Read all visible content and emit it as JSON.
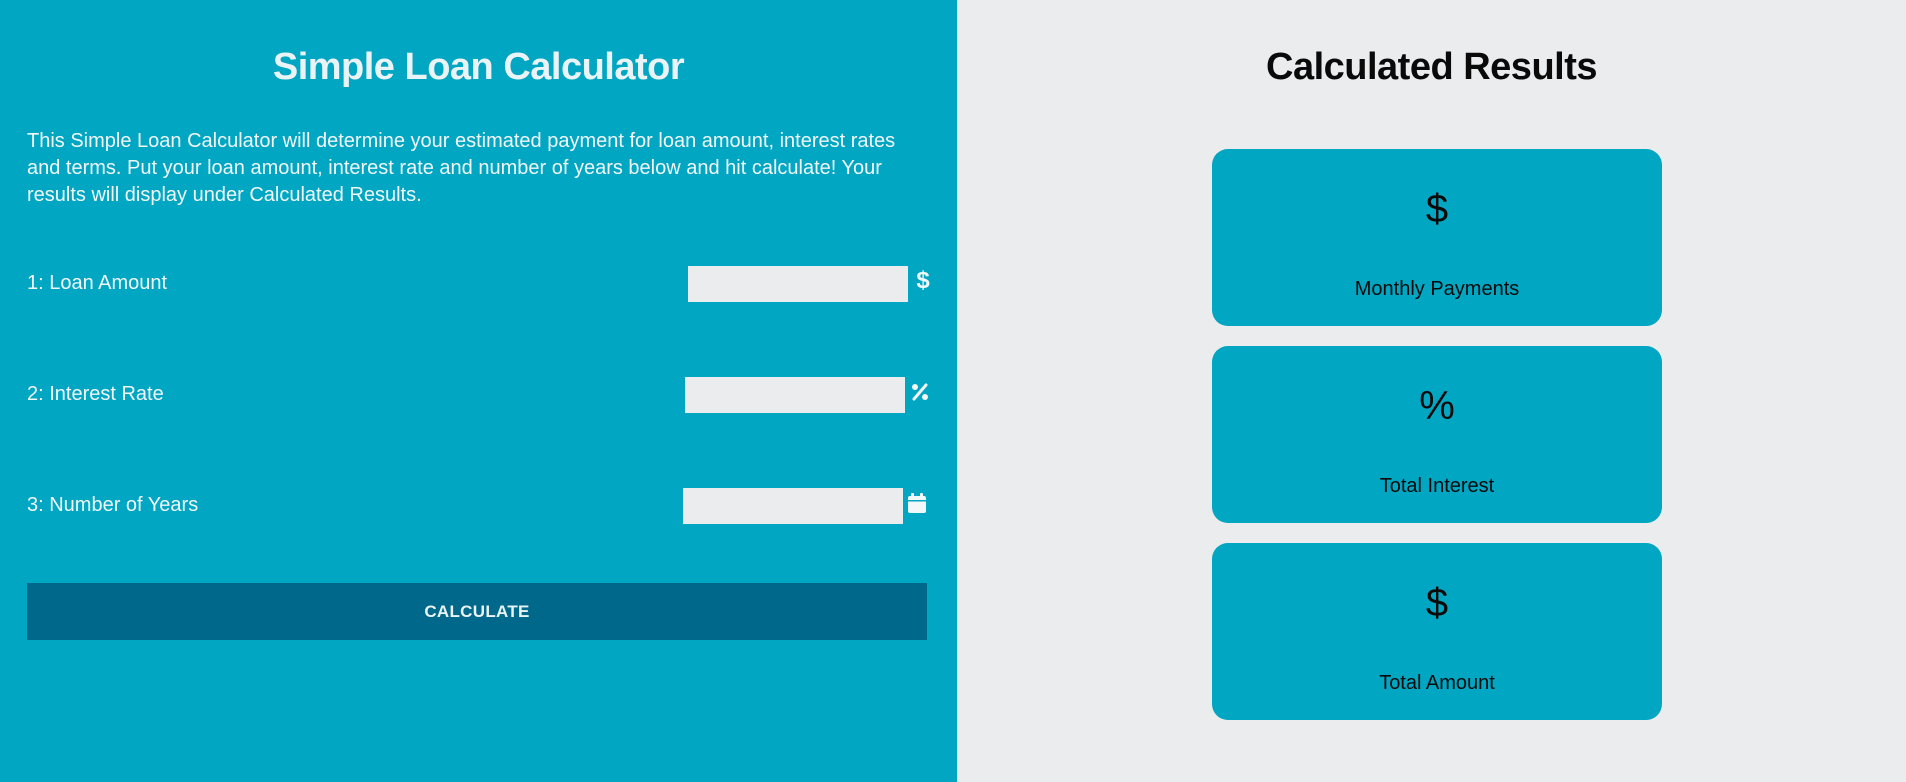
{
  "calculator": {
    "title": "Simple Loan Calculator",
    "description": "This Simple Loan Calculator will determine your estimated payment for loan amount, interest rates and terms. Put your loan amount, interest rate and number of years below and hit calculate! Your results will display under Calculated Results.",
    "fields": [
      {
        "label": "1: Loan Amount",
        "value": "",
        "placeholder": "",
        "icon": "dollar-icon"
      },
      {
        "label": "2: Interest Rate",
        "value": "",
        "placeholder": "",
        "icon": "percent-icon"
      },
      {
        "label": "3: Number of Years",
        "value": "",
        "placeholder": "",
        "icon": "calendar-icon"
      }
    ],
    "button_label": "CALCULATE"
  },
  "results": {
    "title": "Calculated Results",
    "cards": [
      {
        "symbol": "$",
        "label": "Monthly Payments"
      },
      {
        "symbol": "%",
        "label": "Total Interest"
      },
      {
        "symbol": "$",
        "label": "Total Amount"
      }
    ]
  },
  "colors": {
    "accent": "#00a6c2",
    "button": "#00688a",
    "panel": "#ebeced"
  }
}
